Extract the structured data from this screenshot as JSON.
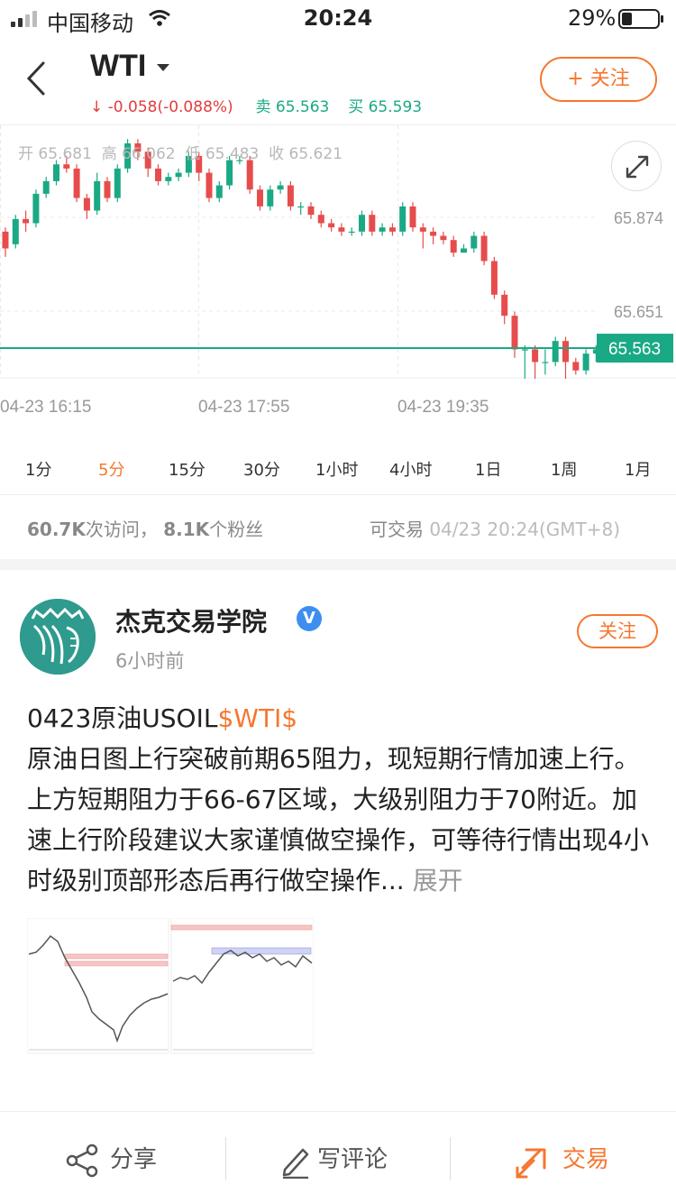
{
  "status_bar": {
    "carrier": "中国移动",
    "time": "20:24",
    "battery": "29%"
  },
  "header": {
    "symbol": "WTI",
    "change": "↓ -0.058(-0.088%)",
    "sell_label": "卖",
    "sell_price": "65.563",
    "buy_label": "买",
    "buy_price": "65.593",
    "follow_label": "+ 关注"
  },
  "ohlc": {
    "open_label": "开",
    "open": "65.681",
    "high_label": "高",
    "high": "66.062",
    "low_label": "低",
    "low": "65.483",
    "close_label": "收",
    "close": "65.621"
  },
  "chart_data": {
    "type": "candlestick",
    "y_ticks": [
      "65.874",
      "65.651"
    ],
    "current_price": "65.563",
    "x_ticks": [
      "04-23 16:15",
      "04-23 17:55",
      "04-23 19:35"
    ],
    "colors": {
      "up": "#1aa985",
      "down": "#e74c4c",
      "price_line": "#1aa985"
    },
    "candles": [
      [
        65.84,
        65.8,
        65.85,
        65.78
      ],
      [
        65.81,
        65.87,
        65.88,
        65.8
      ],
      [
        65.87,
        65.86,
        65.89,
        65.84
      ],
      [
        65.86,
        65.93,
        65.94,
        65.85
      ],
      [
        65.93,
        65.96,
        65.97,
        65.92
      ],
      [
        65.96,
        66.0,
        66.01,
        65.95
      ],
      [
        66.0,
        65.99,
        66.02,
        65.98
      ],
      [
        65.99,
        65.92,
        66.0,
        65.91
      ],
      [
        65.92,
        65.89,
        65.93,
        65.87
      ],
      [
        65.89,
        65.96,
        65.98,
        65.88
      ],
      [
        65.96,
        65.92,
        65.97,
        65.91
      ],
      [
        65.92,
        65.99,
        66.0,
        65.91
      ],
      [
        65.99,
        66.05,
        66.06,
        65.98
      ],
      [
        66.05,
        66.03,
        66.06,
        66.01
      ],
      [
        66.03,
        65.99,
        66.04,
        65.97
      ],
      [
        65.99,
        65.96,
        66.0,
        65.95
      ],
      [
        65.96,
        65.97,
        65.98,
        65.95
      ],
      [
        65.97,
        65.98,
        65.99,
        65.96
      ],
      [
        65.98,
        66.02,
        66.03,
        65.97
      ],
      [
        66.02,
        65.98,
        66.03,
        65.96
      ],
      [
        65.98,
        65.92,
        65.99,
        65.91
      ],
      [
        65.92,
        65.95,
        65.96,
        65.91
      ],
      [
        65.95,
        66.01,
        66.02,
        65.94
      ],
      [
        66.01,
        66.01,
        66.02,
        66.0
      ],
      [
        66.01,
        65.94,
        66.02,
        65.93
      ],
      [
        65.94,
        65.9,
        65.95,
        65.89
      ],
      [
        65.9,
        65.94,
        65.95,
        65.89
      ],
      [
        65.94,
        65.95,
        65.96,
        65.93
      ],
      [
        65.95,
        65.9,
        65.96,
        65.89
      ],
      [
        65.9,
        65.9,
        65.91,
        65.88
      ],
      [
        65.9,
        65.88,
        65.91,
        65.87
      ],
      [
        65.88,
        65.86,
        65.89,
        65.85
      ],
      [
        65.86,
        65.85,
        65.87,
        65.84
      ],
      [
        65.85,
        65.84,
        65.86,
        65.83
      ],
      [
        65.84,
        65.84,
        65.85,
        65.83
      ],
      [
        65.84,
        65.88,
        65.89,
        65.83
      ],
      [
        65.88,
        65.84,
        65.89,
        65.83
      ],
      [
        65.84,
        65.85,
        65.86,
        65.83
      ],
      [
        65.85,
        65.84,
        65.86,
        65.83
      ],
      [
        65.84,
        65.9,
        65.91,
        65.83
      ],
      [
        65.9,
        65.85,
        65.91,
        65.84
      ],
      [
        65.85,
        65.84,
        65.86,
        65.8
      ],
      [
        65.84,
        65.83,
        65.85,
        65.81
      ],
      [
        65.83,
        65.82,
        65.84,
        65.81
      ],
      [
        65.82,
        65.79,
        65.83,
        65.78
      ],
      [
        65.79,
        65.8,
        65.81,
        65.79
      ],
      [
        65.8,
        65.83,
        65.84,
        65.79
      ],
      [
        65.83,
        65.77,
        65.84,
        65.76
      ],
      [
        65.77,
        65.69,
        65.78,
        65.68
      ],
      [
        65.69,
        65.64,
        65.7,
        65.62
      ],
      [
        65.64,
        65.56,
        65.65,
        65.54
      ],
      [
        65.56,
        65.56,
        65.57,
        65.49
      ],
      [
        65.56,
        65.53,
        65.57,
        65.49
      ],
      [
        65.53,
        65.53,
        65.56,
        65.5
      ],
      [
        65.53,
        65.58,
        65.59,
        65.52
      ],
      [
        65.58,
        65.53,
        65.59,
        65.49
      ],
      [
        65.53,
        65.51,
        65.54,
        65.5
      ],
      [
        65.51,
        65.55,
        65.56,
        65.5
      ],
      [
        65.55,
        65.56,
        65.57,
        65.53
      ]
    ]
  },
  "periods": [
    "1分",
    "5分",
    "15分",
    "30分",
    "1小时",
    "4小时",
    "1日",
    "1周",
    "1月"
  ],
  "active_period": "5分",
  "stats": {
    "visits": "60.7K",
    "visits_label": "次访问，",
    "fans": "8.1K",
    "fans_label": "个粉丝"
  },
  "tradable": {
    "label": "可交易",
    "time": "04/23 20:24(GMT+8)"
  },
  "post": {
    "author": "杰克交易学院",
    "verified": "V",
    "time_ago": "6小时前",
    "follow_label": "关注",
    "title_prefix": "0423原油USOIL",
    "tag": "$WTI$",
    "body": "原油日图上行突破前期65阻力，现短期行情加速上行。上方短期阻力于66-67区域，大级别阻力于70附近。加速上行阶段建议大家谨慎做空操作，可等待行情出现4小时级别顶部形态后再行做空操作...",
    "more": "展开"
  },
  "bottom_bar": {
    "share": "分享",
    "comment": "写评论",
    "trade": "交易"
  }
}
